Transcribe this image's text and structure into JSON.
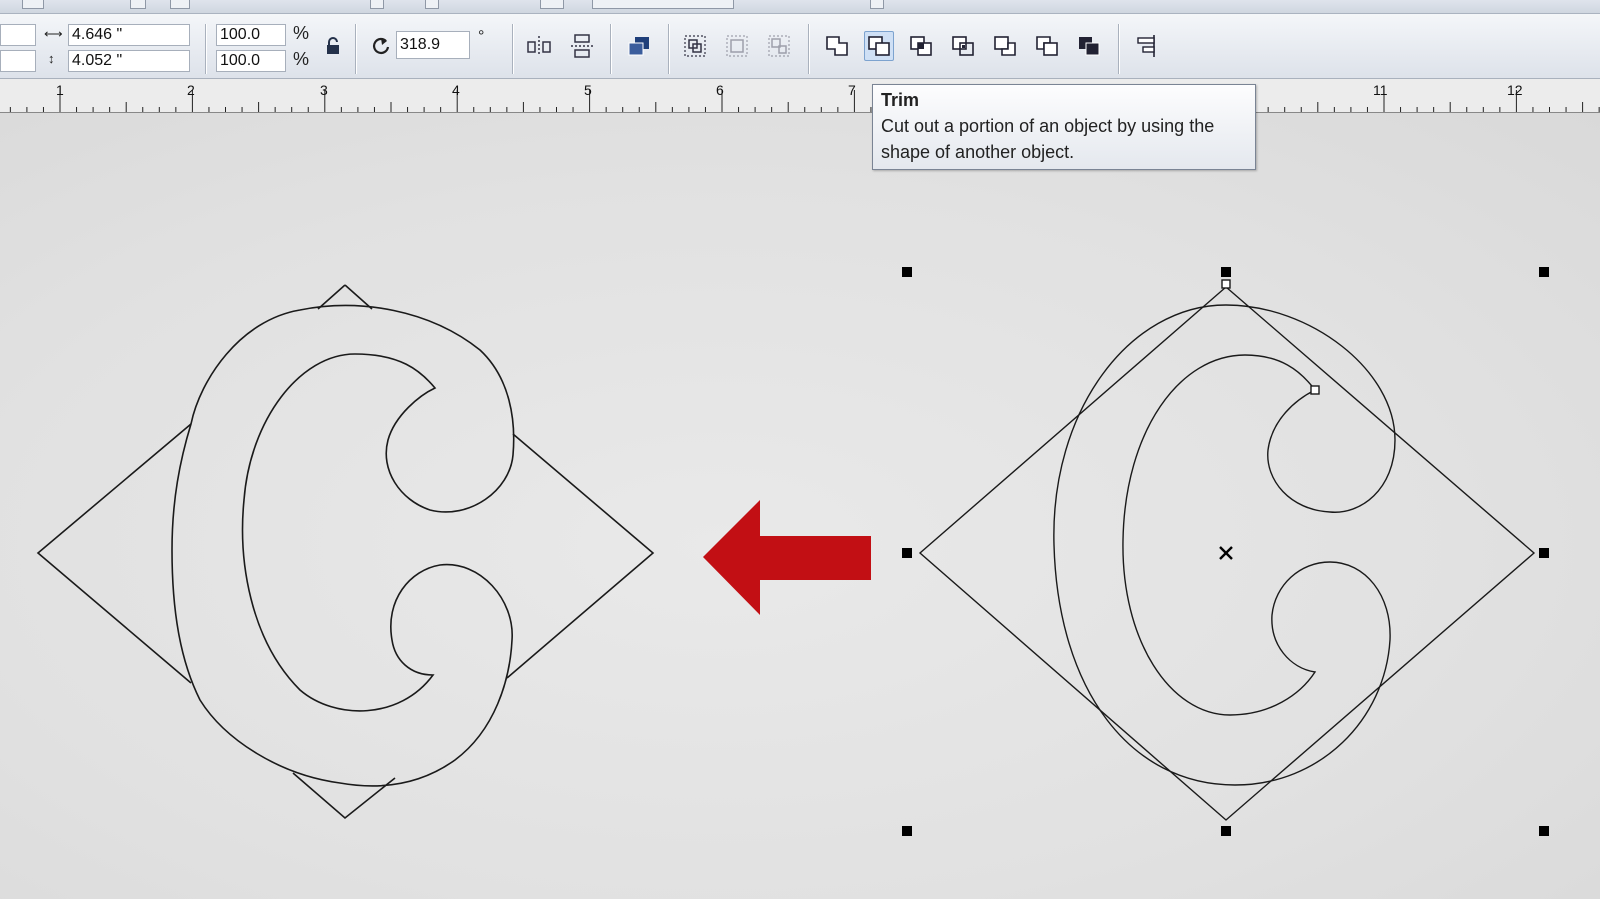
{
  "property_bar": {
    "width_value": "4.646 \"",
    "height_value": "4.052 \"",
    "scale_x": "100.0",
    "scale_y": "100.0",
    "percent": "%",
    "rotation_value": "318.9",
    "degree_symbol": "°"
  },
  "ruler": {
    "labels": [
      "1",
      "2",
      "3",
      "4",
      "5",
      "6",
      "7",
      "11",
      "12"
    ]
  },
  "tooltip": {
    "title": "Trim",
    "description": "Cut out a portion of an object by using the shape of another object."
  },
  "colors": {
    "arrow": "#c20f14",
    "active_button": "#cfe0f5",
    "handle": "#000000"
  },
  "icons": [
    "width-icon",
    "height-icon",
    "lock-icon",
    "rotate-icon",
    "mirror-horizontal-icon",
    "mirror-vertical-icon",
    "arrange-icon",
    "group-icon",
    "ungroup-icon",
    "ungroup-all-icon",
    "weld-icon",
    "trim-icon",
    "intersect-icon",
    "simplify-icon",
    "front-minus-back-icon",
    "back-minus-front-icon",
    "create-boundary-icon",
    "align-distribute-icon"
  ]
}
